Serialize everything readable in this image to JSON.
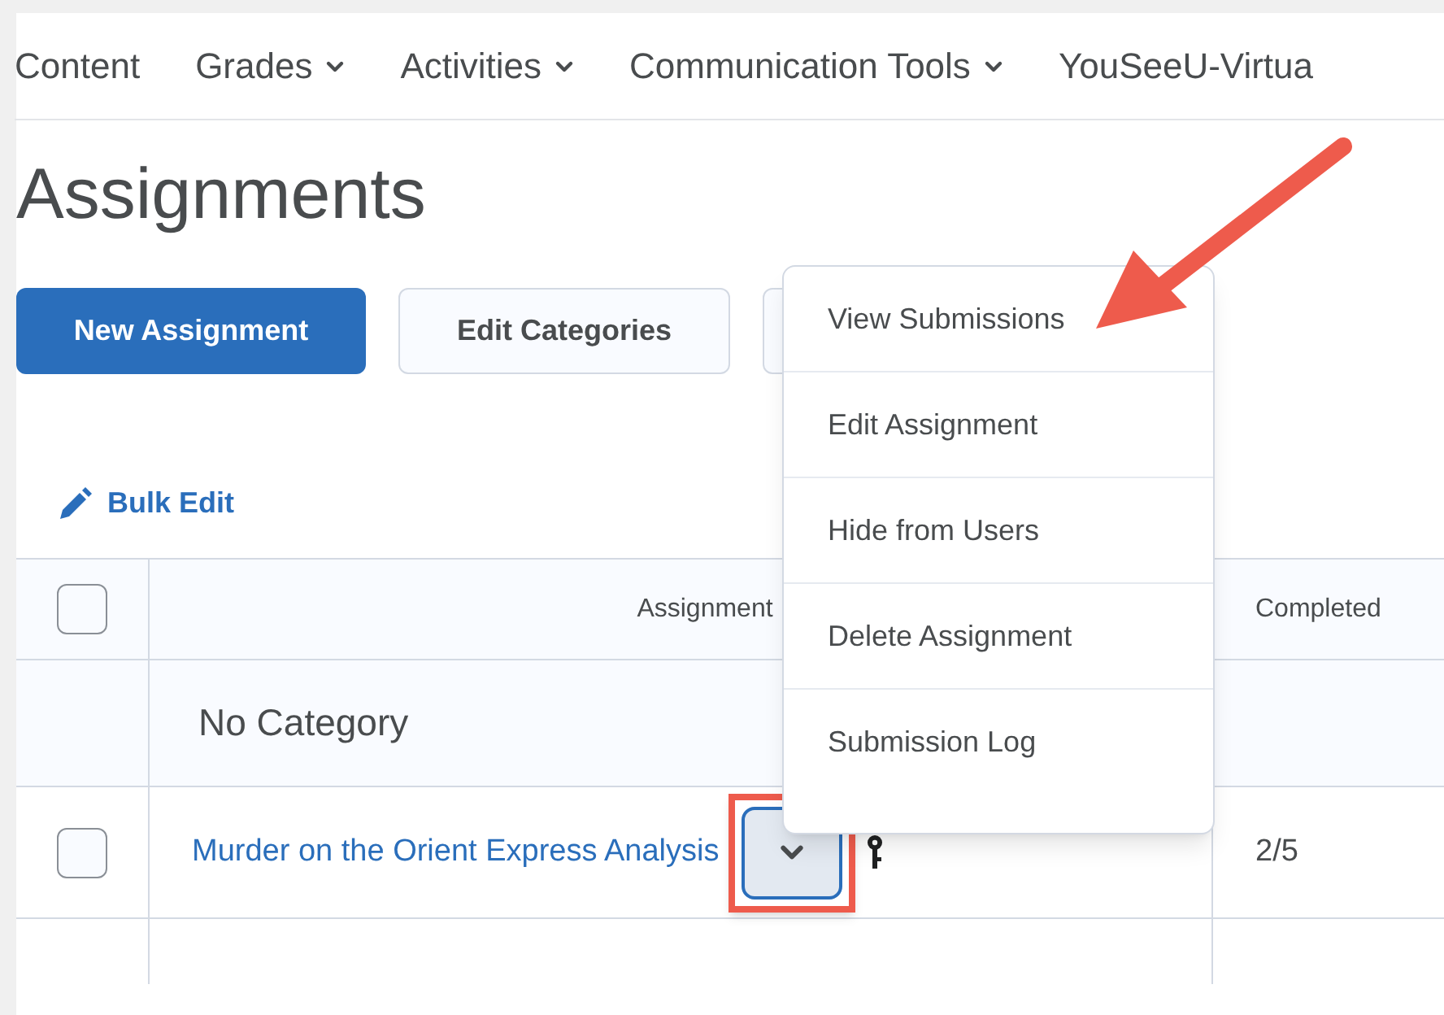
{
  "nav": [
    {
      "label": "Content",
      "has_menu": false
    },
    {
      "label": "Grades",
      "has_menu": true
    },
    {
      "label": "Activities",
      "has_menu": true
    },
    {
      "label": "Communication Tools",
      "has_menu": true
    },
    {
      "label": "YouSeeU-Virtua",
      "has_menu": false
    }
  ],
  "page_title": "Assignments",
  "buttons": [
    {
      "label": "New Assignment",
      "kind": "primary"
    },
    {
      "label": "Edit Categories",
      "kind": "secondary"
    }
  ],
  "bulk_edit": "Bulk Edit",
  "table": {
    "select_all": {
      "checked": false
    },
    "columns": [
      "Assignment",
      "Completed"
    ],
    "category": "No Category",
    "rows": [
      {
        "checked": false,
        "name": "Murder on the Orient Express Analysis",
        "completed": "2/5",
        "menu_open": true,
        "highlighted": true
      }
    ]
  },
  "context_menu": {
    "items": [
      "View Submissions",
      "Edit Assignment",
      "Hide from Users",
      "Delete Assignment",
      "Submission Log"
    ],
    "pointer_arrow": true
  }
}
